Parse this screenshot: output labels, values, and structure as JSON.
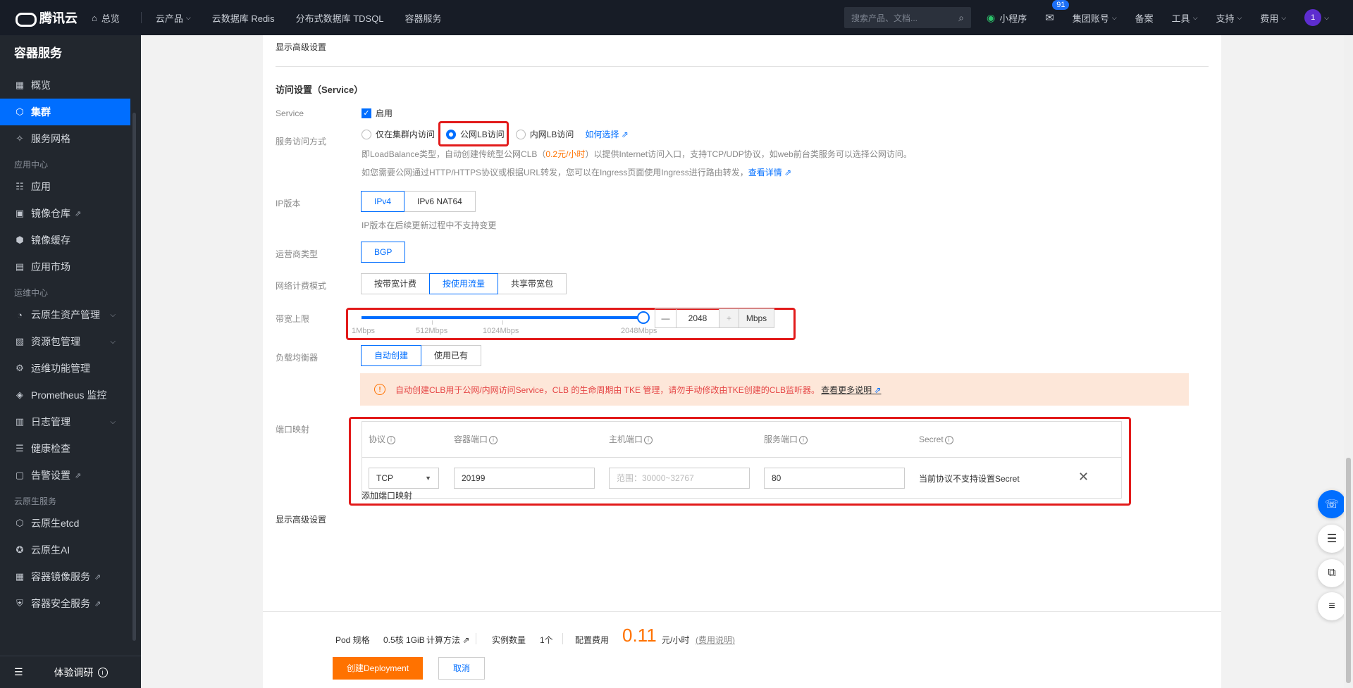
{
  "topbar": {
    "logo": "腾讯云",
    "nav": [
      "总览",
      "云产品",
      "云数据库 Redis",
      "分布式数据库 TDSQL",
      "容器服务"
    ],
    "search_placeholder": "搜索产品、文档...",
    "right": [
      "小程序",
      "集团账号",
      "备案",
      "工具",
      "支持",
      "费用"
    ],
    "badge": "91",
    "avatar": "1"
  },
  "sidebar": {
    "title": "容器服务",
    "items_top": [
      "概览",
      "集群",
      "服务网格"
    ],
    "group_app": "应用中心",
    "items_app": [
      "应用",
      "镜像仓库",
      "镜像缓存",
      "应用市场"
    ],
    "group_ops": "运维中心",
    "items_ops": [
      "云原生资产管理",
      "资源包管理",
      "运维功能管理",
      "Prometheus 监控",
      "日志管理",
      "健康检查",
      "告警设置"
    ],
    "group_cloud": "云原生服务",
    "items_cloud": [
      "云原生etcd",
      "云原生AI",
      "容器镜像服务",
      "容器安全服务"
    ],
    "bottom_label": "体验调研"
  },
  "form": {
    "show_advanced_top": "显示高级设置",
    "section_title": "访问设置（Service）",
    "service_label": "Service",
    "service_checkbox": "启用",
    "access_label": "服务访问方式",
    "access_options": [
      "仅在集群内访问",
      "公网LB访问",
      "内网LB访问"
    ],
    "how_to_choose": "如何选择",
    "desc1_pre": "即LoadBalance类型，自动创建传统型公网CLB（",
    "desc1_price": "0.2元/小时",
    "desc1_post": "）以提供Internet访问入口，支持TCP/UDP协议，如web前台类服务可以选择公网访问。",
    "desc2": "如您需要公网通过HTTP/HTTPS协议或根据URL转发，您可以在Ingress页面使用Ingress进行路由转发，",
    "desc2_link": "查看详情",
    "ip_label": "IP版本",
    "ip_options": [
      "IPv4",
      "IPv6 NAT64"
    ],
    "ip_hint": "IP版本在后续更新过程中不支持变更",
    "isp_label": "运营商类型",
    "isp_option": "BGP",
    "billing_label": "网络计费模式",
    "billing_options": [
      "按带宽计费",
      "按使用流量",
      "共享带宽包"
    ],
    "bandwidth_label": "带宽上限",
    "bandwidth_ticks": [
      "1Mbps",
      "512Mbps",
      "1024Mbps",
      "2048Mbps"
    ],
    "bandwidth_value": "2048",
    "bandwidth_minus": "—",
    "bandwidth_plus": "+",
    "bandwidth_unit": "Mbps",
    "bandwidth_level": 1.0,
    "lb_label": "负载均衡器",
    "lb_options": [
      "自动创建",
      "使用已有"
    ],
    "notice_text": "自动创建CLB用于公网/内网访问Service，CLB 的生命周期由 TKE 管理，请勿手动修改由TKE创建的CLB监听器。",
    "notice_link": "查看更多说明",
    "port_label": "端口映射",
    "port_headers": [
      "协议",
      "容器端口",
      "主机端口",
      "服务端口",
      "Secret"
    ],
    "row": {
      "protocol": "TCP",
      "container_port": "20199",
      "host_port_placeholder": "范围：30000~32767",
      "service_port": "80",
      "secret": "当前协议不支持设置Secret"
    },
    "add_port": "添加端口映射",
    "show_advanced_bottom": "显示高级设置"
  },
  "footer": {
    "pod_spec_label": "Pod 规格",
    "pod_spec_value": "0.5核 1GiB",
    "calc_link": "计算方法",
    "instances_label": "实例数量",
    "instances_value": "1个",
    "cost_label": "配置费用",
    "cost_value": "0.11",
    "cost_unit": "元/小时",
    "cost_link": "费用说明",
    "create_button": "创建Deployment",
    "cancel_button": "取消"
  },
  "colors": {
    "primary": "#006eff",
    "orange": "#ff7200",
    "highlight_red": "#e21b1b"
  }
}
